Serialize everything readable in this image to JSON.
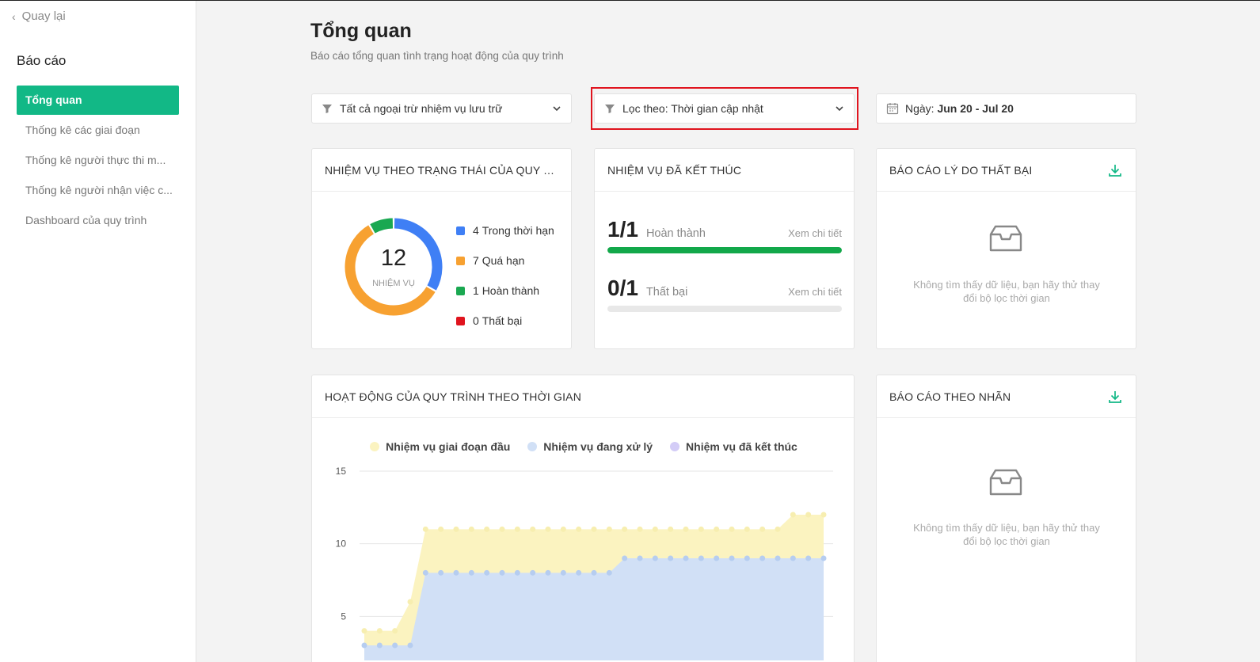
{
  "sidebar": {
    "back_label": "Quay lại",
    "title": "Báo cáo",
    "items": [
      {
        "label": "Tổng quan",
        "active": true
      },
      {
        "label": "Thống kê các giai đoạn",
        "active": false
      },
      {
        "label": "Thống kê người thực thi m...",
        "active": false
      },
      {
        "label": "Thống kê người nhận việc c...",
        "active": false
      },
      {
        "label": "Dashboard của quy trình",
        "active": false
      }
    ]
  },
  "header": {
    "title": "Tổng quan",
    "subtitle": "Báo cáo tổng quan tình trạng hoạt động của quy trình"
  },
  "filters": {
    "scope": "Tất cả ngoại trừ nhiệm vụ lưu trữ",
    "sort": "Lọc theo: Thời gian cập nhật",
    "date_prefix": "Ngày:",
    "date_value": "Jun 20 - Jul 20"
  },
  "status_card": {
    "title": "NHIỆM VỤ THEO TRẠNG THÁI CỦA QUY TRÌ...",
    "total": "12",
    "total_label": "NHIỆM VỤ",
    "legend": [
      {
        "count": "4",
        "label": "Trong thời hạn",
        "color": "#3f7ff5",
        "value": 4
      },
      {
        "count": "7",
        "label": "Quá hạn",
        "color": "#f7a131",
        "value": 7
      },
      {
        "count": "1",
        "label": "Hoàn thành",
        "color": "#1aa851",
        "value": 1
      },
      {
        "count": "0",
        "label": "Thất bại",
        "color": "#e0141e",
        "value": 0
      }
    ]
  },
  "finished_card": {
    "title": "NHIỆM VỤ ĐÃ KẾT THÚC",
    "rows": [
      {
        "value": "1/1",
        "label": "Hoàn thành",
        "link": "Xem chi tiết",
        "fill_fraction": 1.0
      },
      {
        "value": "0/1",
        "label": "Thất bại",
        "link": "Xem chi tiết",
        "fill_fraction": 0.0
      }
    ]
  },
  "fail_card": {
    "title": "BÁO CÁO LÝ DO THẤT BẠI",
    "empty_line1": "Không tìm thấy dữ liệu, bạn hãy thử thay",
    "empty_line2": "đổi bộ lọc thời gian"
  },
  "activity_card": {
    "title": "HOẠT ĐỘNG CỦA QUY TRÌNH THEO THỜI GIAN"
  },
  "label_card": {
    "title": "BÁO CÁO THEO NHÃN",
    "empty_line1": "Không tìm thấy dữ liệu, bạn hãy thử thay",
    "empty_line2": "đổi bộ lọc thời gian"
  },
  "colors": {
    "accent": "#12b886",
    "series_early": "#fbf3c0",
    "series_processing": "#d1e0f6",
    "series_finished": "#d3ccf7"
  },
  "chart_data": {
    "type": "area",
    "yticks": [
      "15",
      "10",
      "5"
    ],
    "ylim": [
      0,
      15
    ],
    "x": [
      1,
      2,
      3,
      4,
      5,
      6,
      7,
      8,
      9,
      10,
      11,
      12,
      13,
      14,
      15,
      16,
      17,
      18,
      19,
      20,
      21,
      22,
      23,
      24,
      25,
      26,
      27,
      28,
      29,
      30,
      31
    ],
    "series": [
      {
        "name": "Nhiệm vụ giai đoạn đầu",
        "color": "#fbf3c0",
        "dot": "#f7eeb0",
        "values": [
          4,
          4,
          4,
          6,
          11,
          11,
          11,
          11,
          11,
          11,
          11,
          11,
          11,
          11,
          11,
          11,
          11,
          11,
          11,
          11,
          11,
          11,
          11,
          11,
          11,
          11,
          11,
          11,
          12,
          12,
          12
        ]
      },
      {
        "name": "Nhiệm vụ đang xử lý",
        "color": "#d1e0f6",
        "dot": "#b6cdf0",
        "values": [
          3,
          3,
          3,
          3,
          8,
          8,
          8,
          8,
          8,
          8,
          8,
          8,
          8,
          8,
          8,
          8,
          8,
          9,
          9,
          9,
          9,
          9,
          9,
          9,
          9,
          9,
          9,
          9,
          9,
          9,
          9
        ]
      },
      {
        "name": "Nhiệm vụ đã kết thúc",
        "color": "#d3ccf7",
        "dot": "#c9c1f5",
        "values": []
      }
    ]
  }
}
